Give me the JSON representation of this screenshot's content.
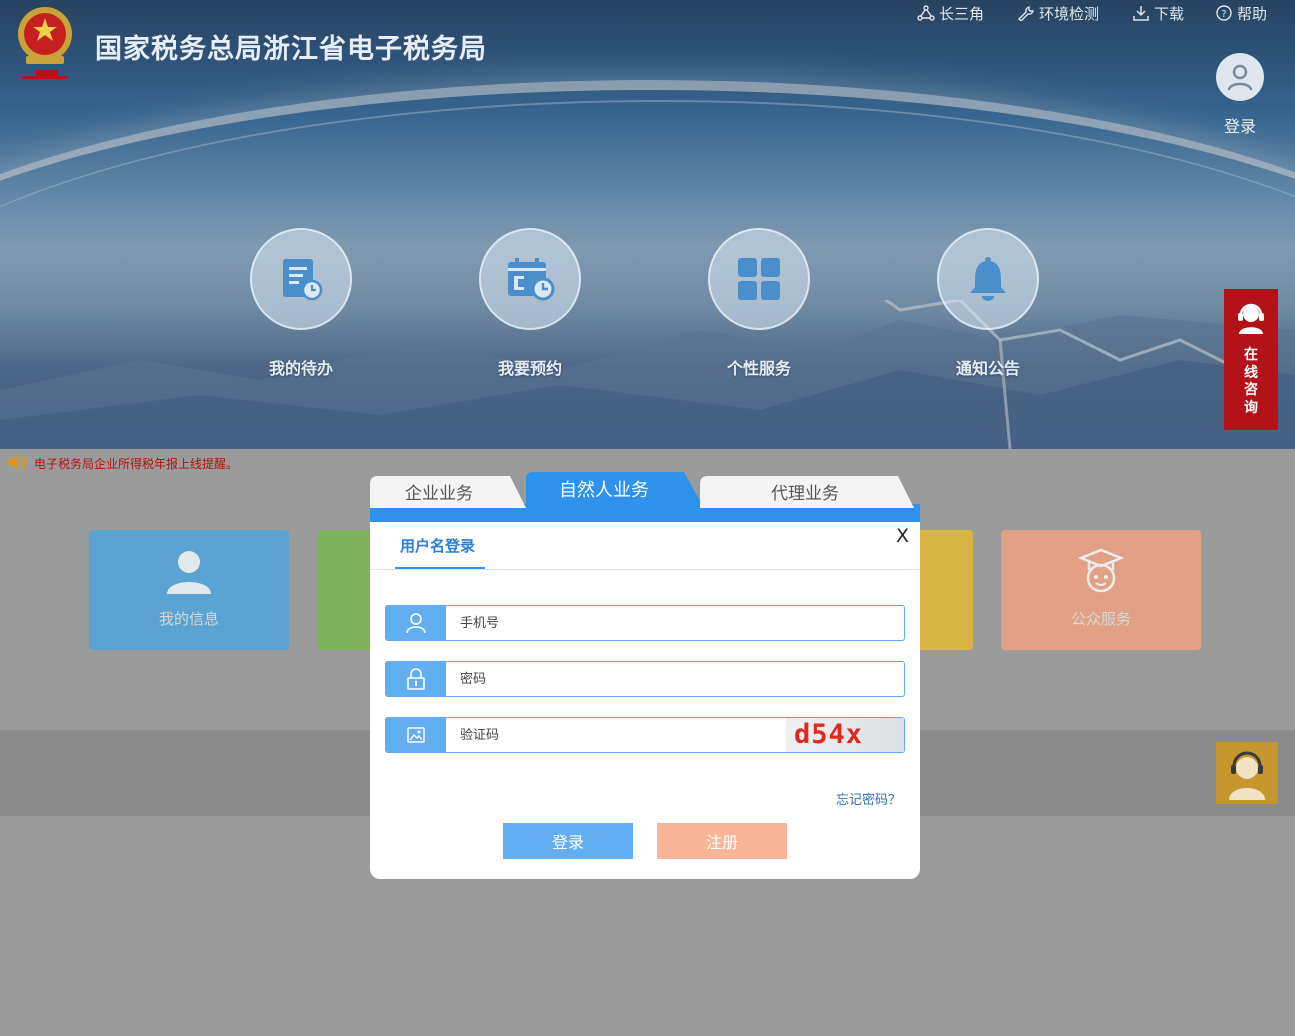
{
  "header": {
    "title": "国家税务总局浙江省电子税务局",
    "links": [
      {
        "label": "长三角",
        "icon": "triangle-nodes-icon"
      },
      {
        "label": "环境检测",
        "icon": "wrench-icon"
      },
      {
        "label": "下载",
        "icon": "download-icon"
      },
      {
        "label": "帮助",
        "icon": "help-circle-icon"
      }
    ],
    "login_label": "登录"
  },
  "quick_nav": [
    {
      "label": "我的待办",
      "icon": "todo-doc-icon"
    },
    {
      "label": "我要预约",
      "icon": "calendar-clock-icon"
    },
    {
      "label": "个性服务",
      "icon": "grid-icon"
    },
    {
      "label": "通知公告",
      "icon": "bell-icon"
    }
  ],
  "consult": {
    "label": "在线咨询",
    "chars": [
      "在",
      "线",
      "咨",
      "询"
    ]
  },
  "notice": {
    "text": "电子税务局企业所得税年报上线提醒。"
  },
  "tiles": [
    {
      "label": "我的信息",
      "color": "#5aa3d2"
    },
    {
      "label": "",
      "color": "#7fb15f"
    },
    {
      "label": "",
      "color": "#d9b544"
    },
    {
      "label": "公众服务",
      "color": "#e2a085"
    }
  ],
  "login_modal": {
    "tabs": [
      "企业业务",
      "自然人业务",
      "代理业务"
    ],
    "active_tab": "自然人业务",
    "close_label": "X",
    "subtab": "用户名登录",
    "fields": {
      "phone": {
        "placeholder": "手机号",
        "value": ""
      },
      "password": {
        "placeholder": "密码",
        "value": ""
      },
      "captcha": {
        "placeholder": "验证码",
        "value": "",
        "image_text": "d54x"
      }
    },
    "forgot_label": "忘记密码？",
    "login_button": "登录",
    "register_button": "注册"
  },
  "colors": {
    "accent": "#2e92ec",
    "login_btn": "#62aef2",
    "register_btn": "#f8b597",
    "consult_bg": "#b41219",
    "notice": "#b3110f"
  }
}
